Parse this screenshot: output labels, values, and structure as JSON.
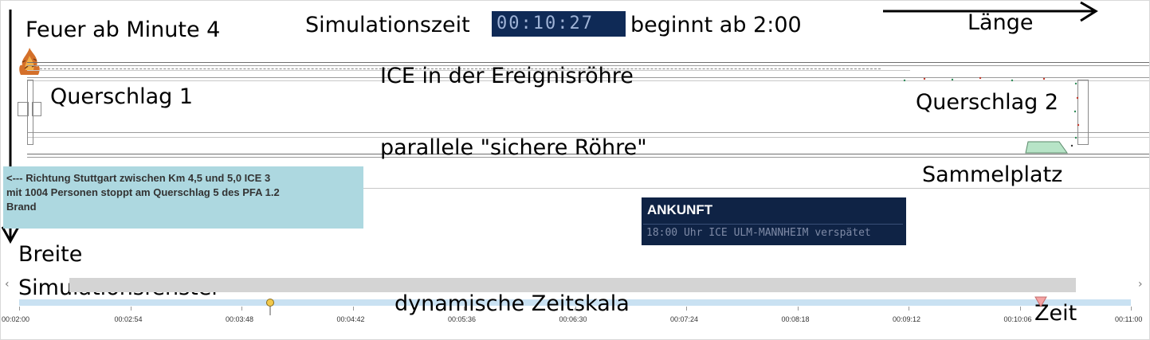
{
  "simulation": {
    "time_label": "Simulationszeit",
    "clock_value": "00:10:27",
    "start_note": "beginnt ab 2:00"
  },
  "annotations": {
    "fire": "Feuer ab Minute 4",
    "length": "Länge",
    "train": "ICE in der Ereignisröhre",
    "cross_passage_1": "Querschlag 1",
    "cross_passage_2": "Querschlag 2",
    "safe_tube": "parallele \"sichere Röhre\"",
    "assembly_point": "Sammelplatz",
    "width": "Breite",
    "window": "Simulationsfenster",
    "timescale": "dynamische Zeitskala",
    "time": "Zeit"
  },
  "info_box": {
    "line1": "<--- Richtung Stuttgart zwischen Km 4,5 und 5,0 ICE 3",
    "line2": "mit 1004 Personen stoppt am Querschlag 5 des PFA 1.2",
    "line3": "Brand"
  },
  "arrival_board": {
    "title": "ANKUNFT",
    "message": "18:00 Uhr ICE ULM-MANNHEIM verspätet"
  },
  "scrollbar": {
    "left_arrow": "‹",
    "right_arrow": "›"
  },
  "timeline": {
    "ticks": [
      "00:02:00",
      "00:02:54",
      "00:03:48",
      "00:04:42",
      "00:05:36",
      "00:06:30",
      "00:07:24",
      "00:08:18",
      "00:09:12",
      "00:10:06",
      "00:11:00"
    ],
    "fire_marker_time": "00:04:00",
    "current_time": "00:10:27"
  },
  "colors": {
    "clock_bg": "#0f2a56",
    "info_box_bg": "#add8e0",
    "board_bg": "#0f2345",
    "timebar": "#c9e1f2",
    "assembly_point_fill": "#b7e4c7",
    "fire_marker": "#f2c94c",
    "playhead_marker": "#f4a3a3"
  },
  "icons": {
    "fire": "fire-icon",
    "fire_marker": "fire-marker-icon",
    "playhead": "playhead-icon"
  }
}
